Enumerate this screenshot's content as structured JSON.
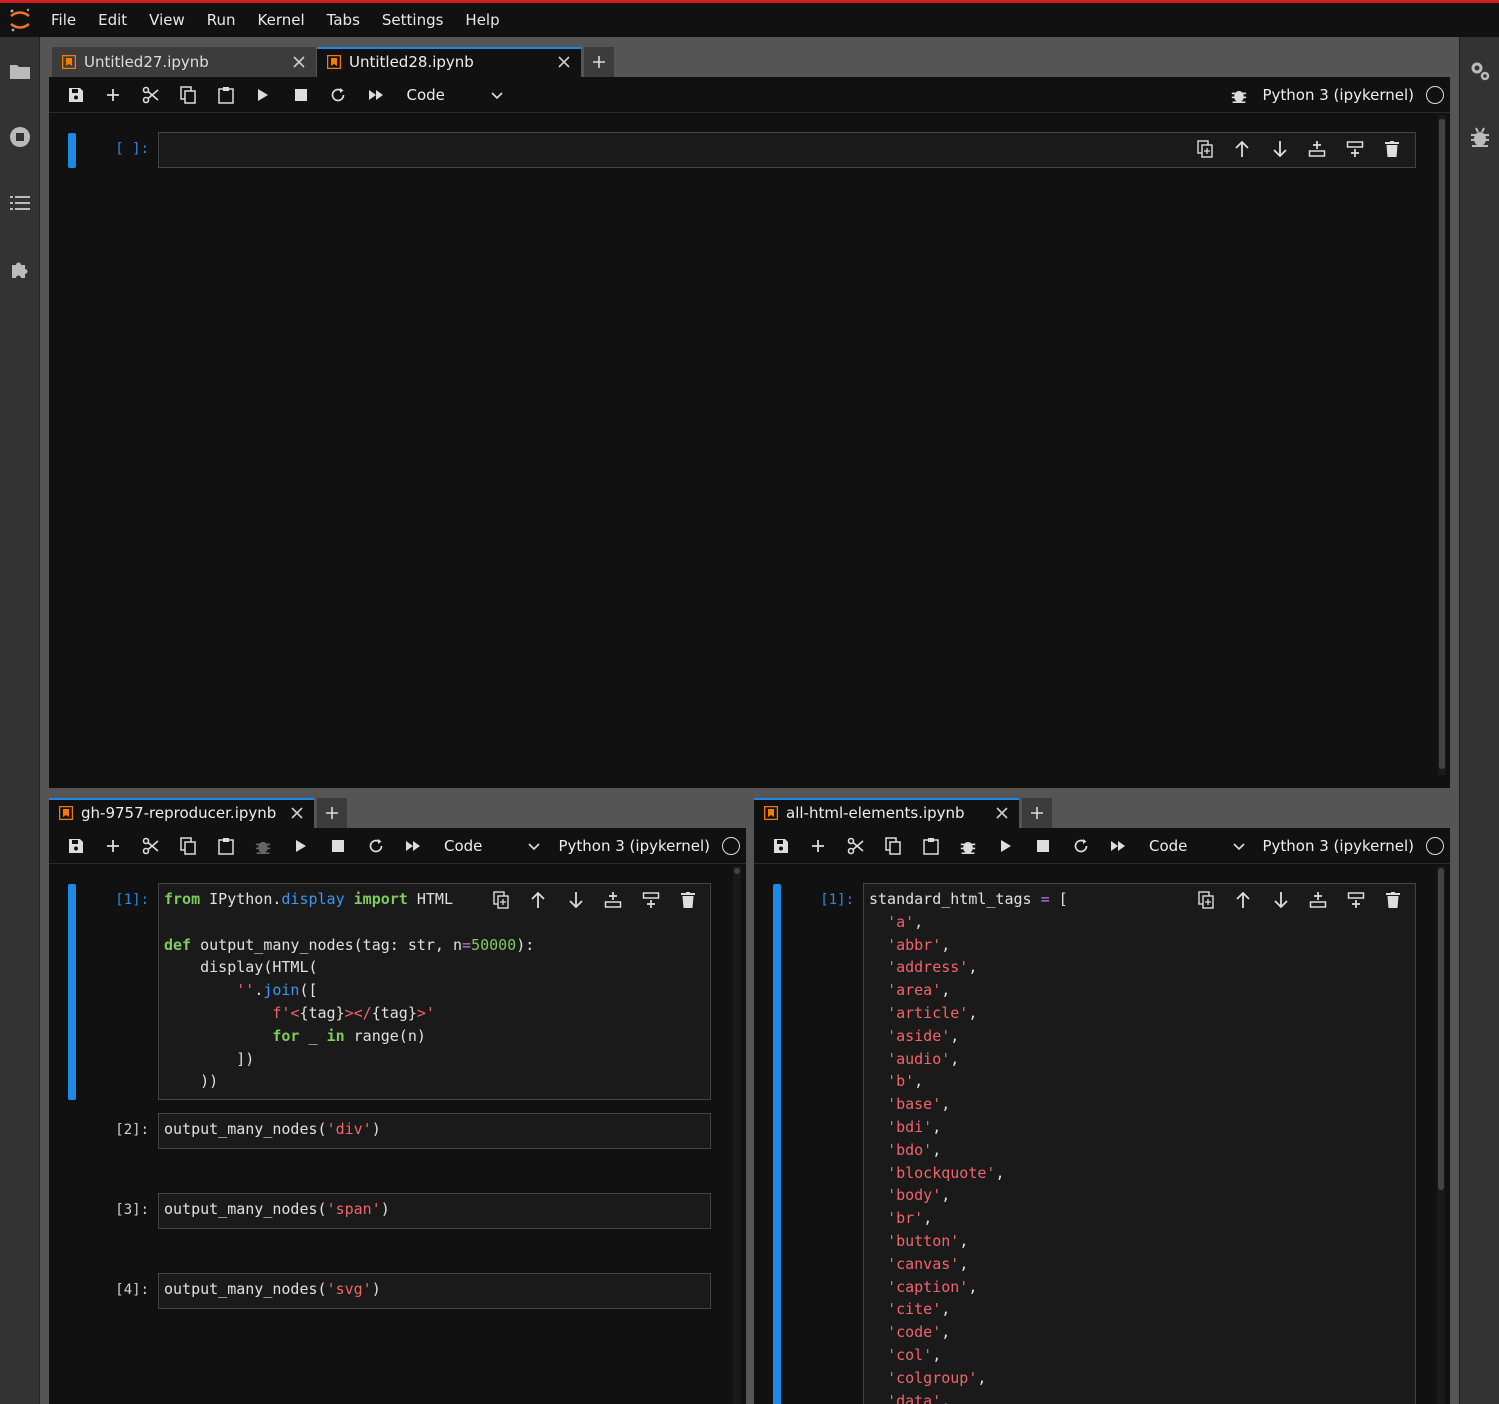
{
  "menu": [
    "File",
    "Edit",
    "View",
    "Run",
    "Kernel",
    "Tabs",
    "Settings",
    "Help"
  ],
  "colors": {
    "accent": "#1e88e5",
    "top_bar": "#d01f1f",
    "notebook_icon": "#f57c00",
    "keyword": "#7ecb5e",
    "string": "#f0646c",
    "function": "#3b98ee"
  },
  "left_sidebar_icons": [
    "folder-icon",
    "running-icon",
    "toc-icon",
    "extension-icon"
  ],
  "right_sidebar_icons": [
    "property-inspector-icon",
    "debugger-icon"
  ],
  "top_panel": {
    "tabs": [
      {
        "label": "Untitled27.ipynb",
        "active": false
      },
      {
        "label": "Untitled28.ipynb",
        "active": true
      }
    ],
    "cell_type": "Code",
    "kernel": "Python 3 (ipykernel)",
    "cells": [
      {
        "prompt": "[ ]:",
        "lines": []
      }
    ]
  },
  "bottom_left_panel": {
    "tabs": [
      {
        "label": "gh-9757-reproducer.ipynb",
        "active": true
      }
    ],
    "cell_type": "Code",
    "kernel": "Python 3 (ipykernel)",
    "cells": [
      {
        "prompt": "[1]:",
        "lines": [
          [
            [
              "kw",
              "from"
            ],
            [
              "pl",
              " IPython."
            ],
            [
              "fn",
              "display"
            ],
            [
              "pl",
              " "
            ],
            [
              "kw",
              "import"
            ],
            [
              "pl",
              " HTML"
            ]
          ],
          [],
          [
            [
              "kw",
              "def"
            ],
            [
              "pl",
              " output_many_nodes(tag: str, n"
            ],
            [
              "op",
              "="
            ],
            [
              "num",
              "50000"
            ],
            [
              "pl",
              "):"
            ]
          ],
          [
            [
              "pl",
              "    display(HTML("
            ]
          ],
          [
            [
              "pl",
              "        "
            ],
            [
              "str",
              "''"
            ],
            [
              "pl",
              "."
            ],
            [
              "fn",
              "join"
            ],
            [
              "pl",
              "(["
            ]
          ],
          [
            [
              "pl",
              "            "
            ],
            [
              "str",
              "f'<"
            ],
            [
              "pl",
              "{tag}"
            ],
            [
              "str",
              "></"
            ],
            [
              "pl",
              "{tag}"
            ],
            [
              "str",
              ">'"
            ]
          ],
          [
            [
              "pl",
              "            "
            ],
            [
              "kw",
              "for"
            ],
            [
              "pl",
              " _ "
            ],
            [
              "kw",
              "in"
            ],
            [
              "pl",
              " range(n)"
            ]
          ],
          [
            [
              "pl",
              "        ])"
            ]
          ],
          [
            [
              "pl",
              "    ))"
            ]
          ]
        ]
      },
      {
        "prompt": "[2]:",
        "lines": [
          [
            [
              "pl",
              "output_many_nodes("
            ],
            [
              "str",
              "'div'"
            ],
            [
              "pl",
              ")"
            ]
          ]
        ]
      },
      {
        "prompt": "[3]:",
        "lines": [
          [
            [
              "pl",
              "output_many_nodes("
            ],
            [
              "str",
              "'span'"
            ],
            [
              "pl",
              ")"
            ]
          ]
        ]
      },
      {
        "prompt": "[4]:",
        "lines": [
          [
            [
              "pl",
              "output_many_nodes("
            ],
            [
              "str",
              "'svg'"
            ],
            [
              "pl",
              ")"
            ]
          ]
        ]
      }
    ]
  },
  "bottom_right_panel": {
    "tabs": [
      {
        "label": "all-html-elements.ipynb",
        "active": true
      }
    ],
    "cell_type": "Code",
    "kernel": "Python 3 (ipykernel)",
    "cells": [
      {
        "prompt": "[1]:",
        "lines": [
          [
            [
              "pl",
              "standard_html_tags "
            ],
            [
              "op",
              "="
            ],
            [
              "pl",
              " ["
            ]
          ],
          [
            [
              "pl",
              "  "
            ],
            [
              "str",
              "'a'"
            ],
            [
              "pl",
              ","
            ]
          ],
          [
            [
              "pl",
              "  "
            ],
            [
              "str",
              "'abbr'"
            ],
            [
              "pl",
              ","
            ]
          ],
          [
            [
              "pl",
              "  "
            ],
            [
              "str",
              "'address'"
            ],
            [
              "pl",
              ","
            ]
          ],
          [
            [
              "pl",
              "  "
            ],
            [
              "str",
              "'area'"
            ],
            [
              "pl",
              ","
            ]
          ],
          [
            [
              "pl",
              "  "
            ],
            [
              "str",
              "'article'"
            ],
            [
              "pl",
              ","
            ]
          ],
          [
            [
              "pl",
              "  "
            ],
            [
              "str",
              "'aside'"
            ],
            [
              "pl",
              ","
            ]
          ],
          [
            [
              "pl",
              "  "
            ],
            [
              "str",
              "'audio'"
            ],
            [
              "pl",
              ","
            ]
          ],
          [
            [
              "pl",
              "  "
            ],
            [
              "str",
              "'b'"
            ],
            [
              "pl",
              ","
            ]
          ],
          [
            [
              "pl",
              "  "
            ],
            [
              "str",
              "'base'"
            ],
            [
              "pl",
              ","
            ]
          ],
          [
            [
              "pl",
              "  "
            ],
            [
              "str",
              "'bdi'"
            ],
            [
              "pl",
              ","
            ]
          ],
          [
            [
              "pl",
              "  "
            ],
            [
              "str",
              "'bdo'"
            ],
            [
              "pl",
              ","
            ]
          ],
          [
            [
              "pl",
              "  "
            ],
            [
              "str",
              "'blockquote'"
            ],
            [
              "pl",
              ","
            ]
          ],
          [
            [
              "pl",
              "  "
            ],
            [
              "str",
              "'body'"
            ],
            [
              "pl",
              ","
            ]
          ],
          [
            [
              "pl",
              "  "
            ],
            [
              "str",
              "'br'"
            ],
            [
              "pl",
              ","
            ]
          ],
          [
            [
              "pl",
              "  "
            ],
            [
              "str",
              "'button'"
            ],
            [
              "pl",
              ","
            ]
          ],
          [
            [
              "pl",
              "  "
            ],
            [
              "str",
              "'canvas'"
            ],
            [
              "pl",
              ","
            ]
          ],
          [
            [
              "pl",
              "  "
            ],
            [
              "str",
              "'caption'"
            ],
            [
              "pl",
              ","
            ]
          ],
          [
            [
              "pl",
              "  "
            ],
            [
              "str",
              "'cite'"
            ],
            [
              "pl",
              ","
            ]
          ],
          [
            [
              "pl",
              "  "
            ],
            [
              "str",
              "'code'"
            ],
            [
              "pl",
              ","
            ]
          ],
          [
            [
              "pl",
              "  "
            ],
            [
              "str",
              "'col'"
            ],
            [
              "pl",
              ","
            ]
          ],
          [
            [
              "pl",
              "  "
            ],
            [
              "str",
              "'colgroup'"
            ],
            [
              "pl",
              ","
            ]
          ],
          [
            [
              "pl",
              "  "
            ],
            [
              "str",
              "'data'"
            ],
            [
              "pl",
              ","
            ]
          ]
        ]
      }
    ]
  }
}
